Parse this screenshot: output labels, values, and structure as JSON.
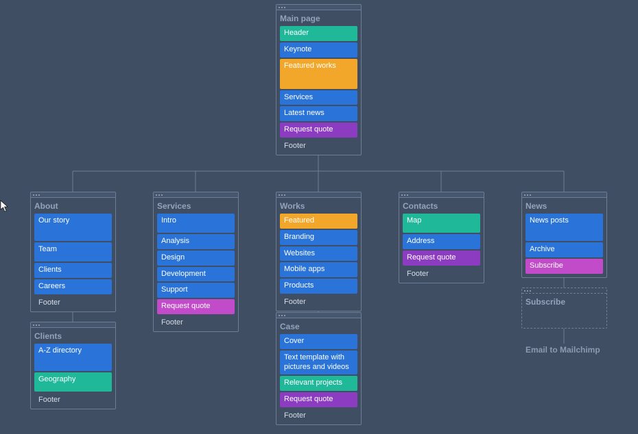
{
  "colors": {
    "blue": "#2a73d8",
    "teal": "#1fb99a",
    "orange": "#f2a72b",
    "purple": "#8c3cc0",
    "magenta": "#c14bc9"
  },
  "cards": {
    "main": {
      "title": "Main page",
      "items": [
        {
          "label": "Header",
          "color": "teal",
          "h": 16
        },
        {
          "label": "Keynote",
          "color": "blue",
          "h": 16
        },
        {
          "label": "Featured works",
          "color": "orange",
          "h": 44
        },
        {
          "label": "Services",
          "color": "blue",
          "h": 16
        },
        {
          "label": "Latest news",
          "color": "blue",
          "h": 16
        },
        {
          "label": "Request quote",
          "color": "purple",
          "h": 16
        }
      ],
      "footer": "Footer"
    },
    "about": {
      "title": "About",
      "items": [
        {
          "label": "Our story",
          "color": "blue",
          "h": 40
        },
        {
          "label": "Team",
          "color": "blue",
          "h": 28
        },
        {
          "label": "Clients",
          "color": "blue",
          "h": 16
        },
        {
          "label": "Careers",
          "color": "blue",
          "h": 16
        }
      ],
      "footer": "Footer"
    },
    "clients": {
      "title": "Clients",
      "items": [
        {
          "label": "A-Z directory",
          "color": "blue",
          "h": 40
        },
        {
          "label": "Geography",
          "color": "teal",
          "h": 28
        }
      ],
      "footer": "Footer"
    },
    "services": {
      "title": "Services",
      "items": [
        {
          "label": "Intro",
          "color": "blue",
          "h": 28
        },
        {
          "label": "Analysis",
          "color": "blue",
          "h": 16
        },
        {
          "label": "Design",
          "color": "blue",
          "h": 16
        },
        {
          "label": "Development",
          "color": "blue",
          "h": 16
        },
        {
          "label": "Support",
          "color": "blue",
          "h": 16
        },
        {
          "label": "Request quote",
          "color": "magenta",
          "h": 16
        }
      ],
      "footer": "Footer"
    },
    "works": {
      "title": "Works",
      "items": [
        {
          "label": "Featured",
          "color": "orange",
          "h": 16
        },
        {
          "label": "Branding",
          "color": "blue",
          "h": 16
        },
        {
          "label": "Websites",
          "color": "blue",
          "h": 16
        },
        {
          "label": "Mobile apps",
          "color": "blue",
          "h": 16
        },
        {
          "label": "Products",
          "color": "blue",
          "h": 16
        }
      ],
      "footer": "Footer"
    },
    "case": {
      "title": "Case",
      "items": [
        {
          "label": "Cover",
          "color": "blue",
          "h": 16
        },
        {
          "label": "Text template with pictures and videos",
          "color": "blue",
          "h": 28
        },
        {
          "label": "Relevant projects",
          "color": "teal",
          "h": 16
        },
        {
          "label": "Request quote",
          "color": "purple",
          "h": 16
        }
      ],
      "footer": "Footer"
    },
    "contacts": {
      "title": "Contacts",
      "items": [
        {
          "label": "Map",
          "color": "teal",
          "h": 28
        },
        {
          "label": "Address",
          "color": "blue",
          "h": 16
        },
        {
          "label": "Request quote",
          "color": "purple",
          "h": 16
        }
      ],
      "footer": "Footer"
    },
    "news": {
      "title": "News",
      "items": [
        {
          "label": "News posts",
          "color": "blue",
          "h": 40
        },
        {
          "label": "Archive",
          "color": "blue",
          "h": 16
        },
        {
          "label": "Subscribe",
          "color": "magenta",
          "h": 16
        }
      ]
    },
    "subscribe": {
      "title": "Subscribe"
    }
  },
  "labels": {
    "mailchimp": "Email to Mailchimp"
  }
}
